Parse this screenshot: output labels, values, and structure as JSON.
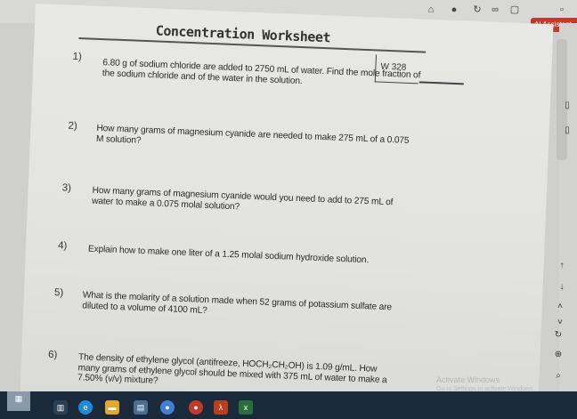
{
  "browser": {
    "ai_button_label": "AI Assistant"
  },
  "worksheet": {
    "title": "Concentration Worksheet",
    "code": "W 328",
    "questions": [
      {
        "number": "1)",
        "text": "6.80 g of sodium chloride are added to 2750 mL of water. Find the mole fraction of the sodium chloride and of the water in the solution."
      },
      {
        "number": "2)",
        "text": "How many grams of magnesium cyanide are needed to make 275 mL of a 0.075 M solution?"
      },
      {
        "number": "3)",
        "text": "How many grams of magnesium cyanide would you need to add to 275 mL of water to make a 0.075 molal solution?"
      },
      {
        "number": "4)",
        "text": "Explain how to make one liter of a 1.25 molal sodium hydroxide solution."
      },
      {
        "number": "5)",
        "text": "What is the molarity of a solution made when 52 grams of potassium sulfate are diluted to a volume of 4100 mL?"
      },
      {
        "number": "6)",
        "text": "The density of ethylene glycol (antifreeze, HOCH₂CH₂OH) is 1.09 g/mL. How many grams of ethylene glycol should be mixed with 375 mL of water to make a 7.50% (v/v) mixture?"
      }
    ]
  },
  "watermark": {
    "line1": "Activate Windows",
    "line2": "Go to Settings to activate Windows."
  },
  "colors": {
    "taskbar": "#1b2a3b",
    "ai_button": "#c0392b",
    "paper": "#e4e4e1"
  }
}
